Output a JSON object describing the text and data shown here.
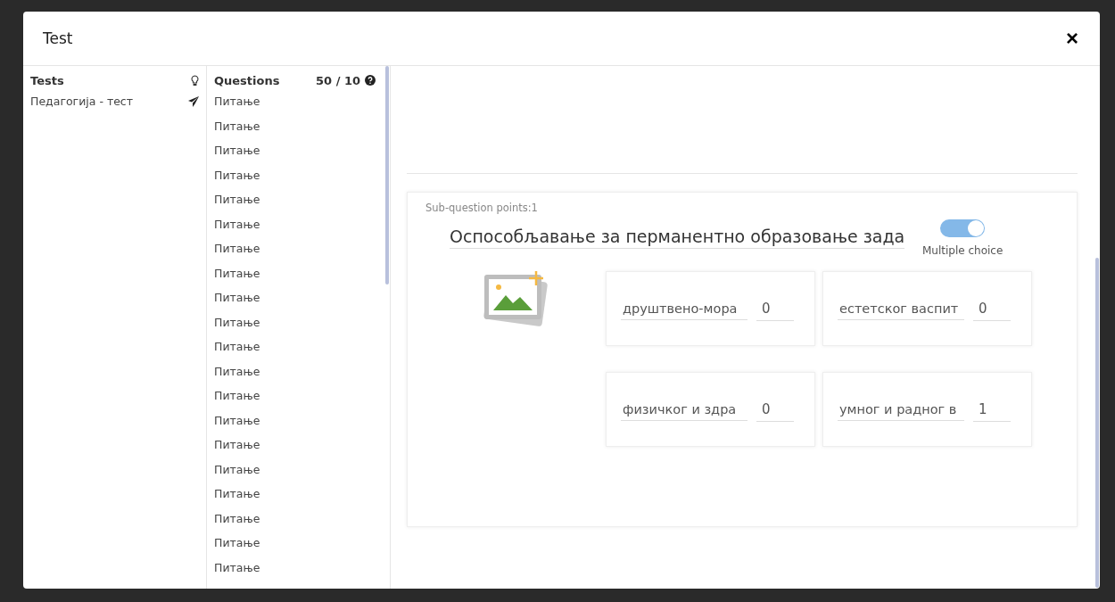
{
  "window": {
    "title": "Test",
    "close": "×"
  },
  "tests": {
    "title": "Tests",
    "items": [
      {
        "label": "Педагогија - тест",
        "selected": false
      }
    ]
  },
  "questions": {
    "title": "Questions",
    "count": "50 / 10",
    "items": [
      "Питање",
      "Питање",
      "Питање",
      "Питање",
      "Питање",
      "Питање",
      "Питање",
      "Питање",
      "Питање",
      "Питање",
      "Питање",
      "Питање",
      "Питање",
      "Питање",
      "Питање",
      "Питање",
      "Питање",
      "Питање",
      "Питање",
      "Питање"
    ]
  },
  "sub_question": {
    "points": "Sub-question points:1",
    "text": "Оспособљавање за перманентно образовање зада",
    "multiple_choice": {
      "label": "Multiple choice",
      "on": true
    },
    "answers": [
      {
        "text": "друштвено-мора",
        "points": "0"
      },
      {
        "text": "естетског васпит",
        "points": "0"
      },
      {
        "text": "физичког и здра",
        "points": "0"
      },
      {
        "text": "умног и радног в",
        "points": "1"
      }
    ]
  }
}
